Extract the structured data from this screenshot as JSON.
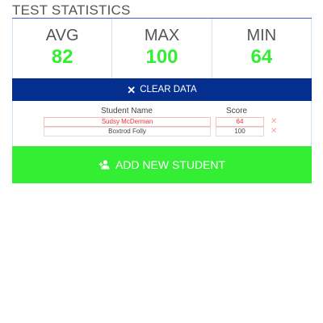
{
  "header": {
    "title": "TEST STATISTICS"
  },
  "stats": {
    "avg": {
      "label": "AVG",
      "value": "82"
    },
    "max": {
      "label": "MAX",
      "value": "100"
    },
    "min": {
      "label": "MIN",
      "value": "64"
    }
  },
  "clear_button": {
    "icon": "close-icon",
    "label": "CLEAR DATA"
  },
  "table": {
    "headers": {
      "name": "Student Name",
      "score": "Score"
    },
    "rows": [
      {
        "name": "Sudsy McDerman",
        "score": "64",
        "status": "lowest"
      },
      {
        "name": "Boxtrod Folly",
        "score": "100",
        "status": "normal"
      }
    ]
  },
  "add_button": {
    "icon": "add-user-icon",
    "label": "ADD NEW STUDENT"
  },
  "colors": {
    "accent_green": "#33ee33",
    "clear_blue": "#052f8f",
    "low_red": "#ee3333"
  }
}
